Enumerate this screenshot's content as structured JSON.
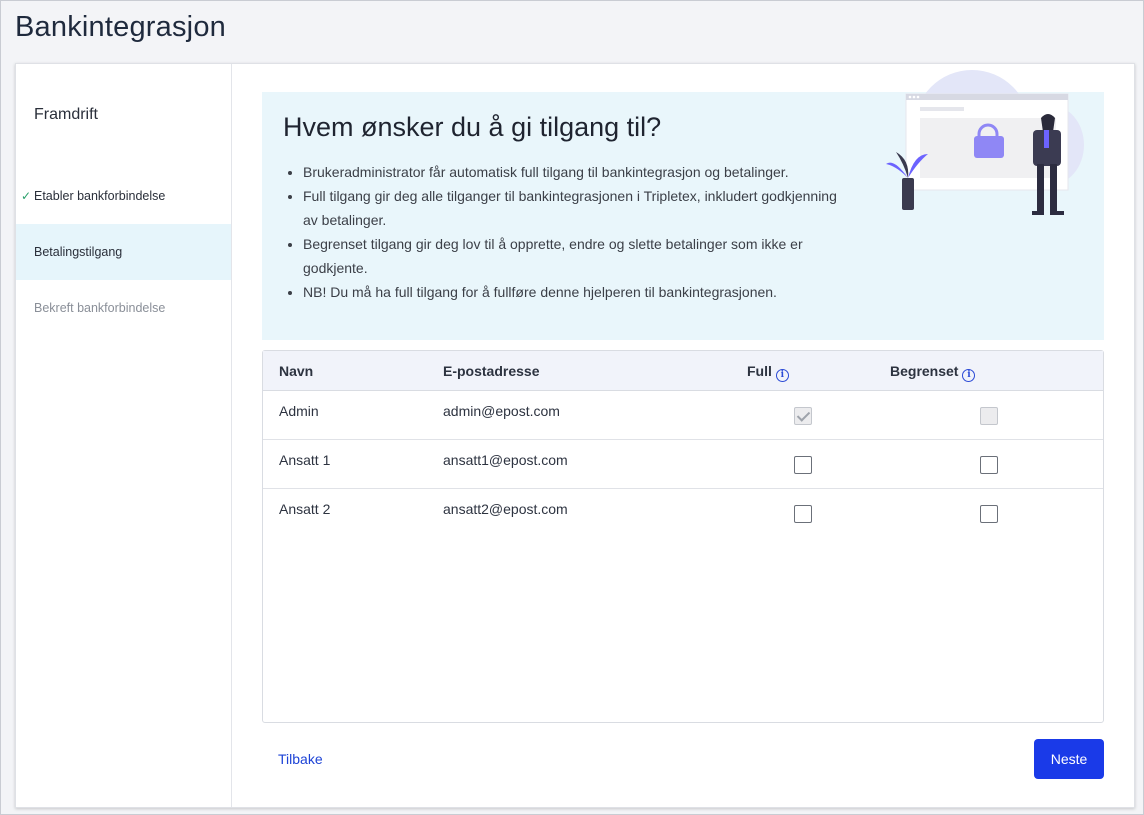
{
  "page": {
    "title": "Bankintegrasjon"
  },
  "sidebar": {
    "heading": "Framdrift",
    "steps": [
      {
        "label": "Etabler bankforbindelse",
        "state": "done"
      },
      {
        "label": "Betalingstilgang",
        "state": "active"
      },
      {
        "label": "Bekreft bankforbindelse",
        "state": "pending"
      }
    ]
  },
  "info": {
    "title": "Hvem ønsker du å gi tilgang til?",
    "bullets": [
      "Brukeradministrator får automatisk full tilgang til bankintegrasjon og betalinger.",
      "Full tilgang gir deg alle tilganger til bankintegrasjonen i Tripletex, inkludert godkjenning av betalinger.",
      "Begrenset tilgang gir deg lov til å opprette, endre og slette betalinger som ikke er godkjente.",
      "NB! Du må ha full tilgang for å fullføre denne hjelperen til bankintegrasjonen."
    ]
  },
  "table": {
    "columns": {
      "name": "Navn",
      "email": "E-postadresse",
      "full": "Full",
      "limited": "Begrenset"
    },
    "rows": [
      {
        "name": "Admin",
        "email": "admin@epost.com",
        "full": true,
        "limited": false,
        "disabled": true
      },
      {
        "name": "Ansatt 1",
        "email": "ansatt1@epost.com",
        "full": false,
        "limited": false,
        "disabled": false
      },
      {
        "name": "Ansatt 2",
        "email": "ansatt2@epost.com",
        "full": false,
        "limited": false,
        "disabled": false
      }
    ]
  },
  "footer": {
    "back_label": "Tilbake",
    "next_label": "Neste"
  },
  "colors": {
    "primary": "#1a3ae8",
    "link": "#1d43d6",
    "info_bg": "#e9f6fb",
    "active_step_bg": "#e6f5fb",
    "check": "#29a06a",
    "illustration_purple": "#6c63ff"
  },
  "icons": {
    "step_done": "check-icon",
    "column_info": "info-icon"
  }
}
